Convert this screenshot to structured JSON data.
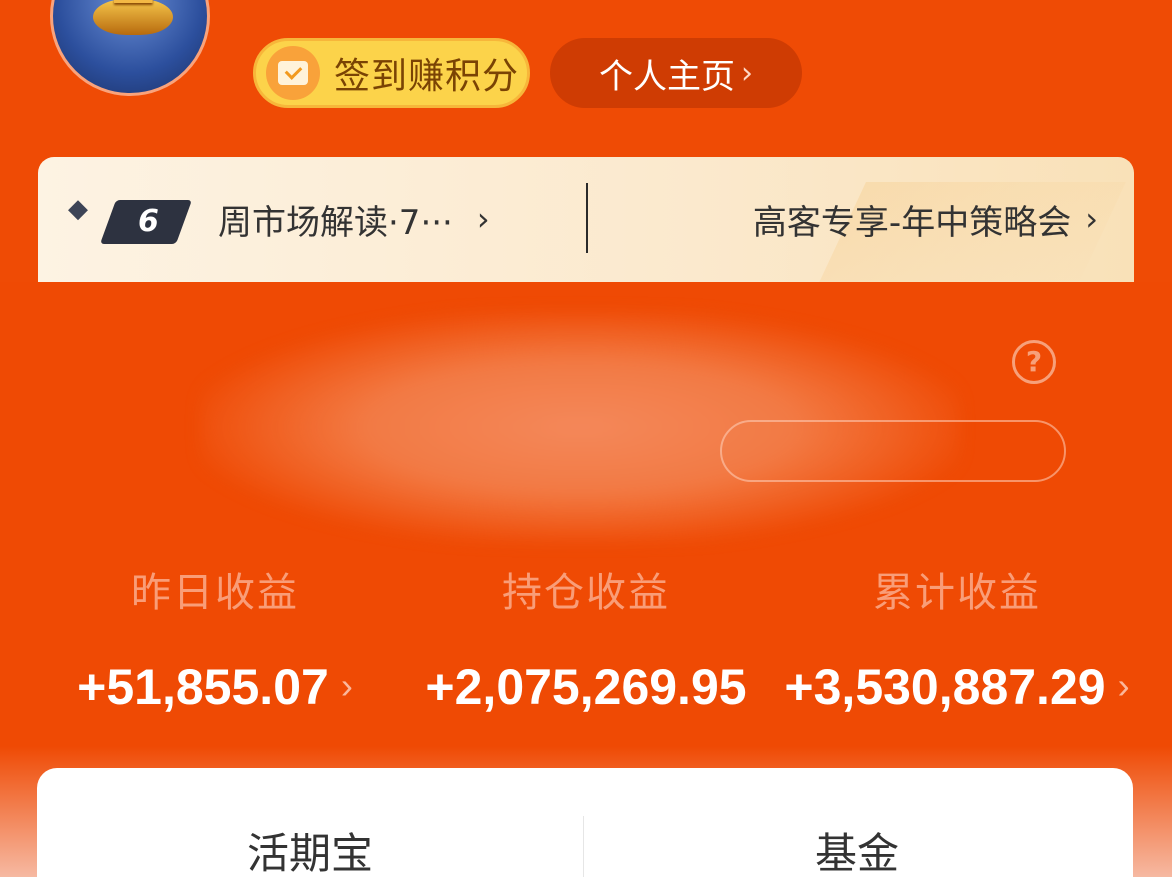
{
  "header": {
    "checkin_label": "签到赚积分",
    "home_label": "个人主页",
    "home_chevron": "›"
  },
  "banner": {
    "badge_number": "6",
    "item1_label": "周市场解读·7···",
    "item1_chevron": "›",
    "item2_label": "高客专享-年中策略会",
    "item2_chevron": "›"
  },
  "help": {
    "icon_text": "?"
  },
  "earnings": [
    {
      "label": "昨日收益",
      "value": "+51,855.07",
      "chevron": "›"
    },
    {
      "label": "持仓收益",
      "value": "+2,075,269.95",
      "chevron": ""
    },
    {
      "label": "累计收益",
      "value": "+3,530,887.29",
      "chevron": "›"
    }
  ],
  "tabs": [
    {
      "label": "活期宝"
    },
    {
      "label": "基金"
    }
  ],
  "colors": {
    "primary_orange": "#ef4b05",
    "checkin_yellow": "#fcd34a",
    "label_pink": "#f99d78"
  },
  "icons": [
    "avatar-coin-icon",
    "calendar-check-icon",
    "diamond-icon",
    "help-circle-icon",
    "chevron-right-icon"
  ]
}
